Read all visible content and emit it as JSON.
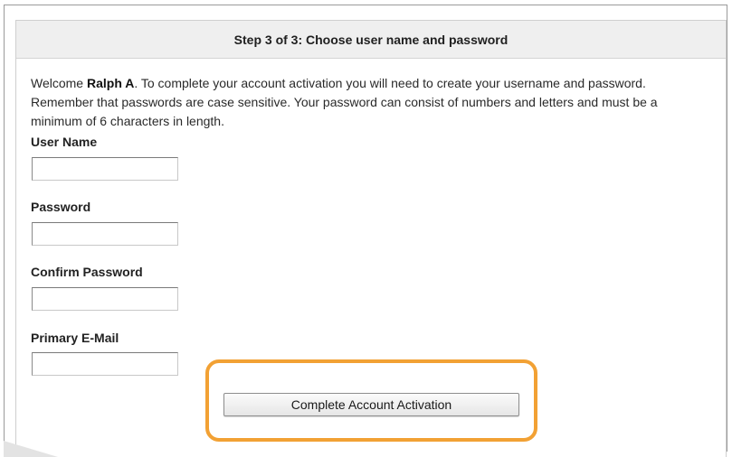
{
  "header": {
    "title": "Step 3 of 3: Choose user name and password"
  },
  "intro": {
    "prefix": "Welcome ",
    "name": "Ralph A",
    "text": ". To complete your account activation you will need to create your username and password. Remember that passwords are case sensitive. Your password can consist of numbers and letters and must be a minimum of 6 characters in length."
  },
  "form": {
    "user_name_label": "User Name",
    "user_name_value": "",
    "password_label": "Password",
    "password_value": "",
    "confirm_password_label": "Confirm Password",
    "confirm_password_value": "",
    "email_label": "Primary E-Mail",
    "email_value": "",
    "submit_label": "Complete Account Activation"
  },
  "colors": {
    "highlight": "#f2a134",
    "header_background": "#efefef"
  }
}
